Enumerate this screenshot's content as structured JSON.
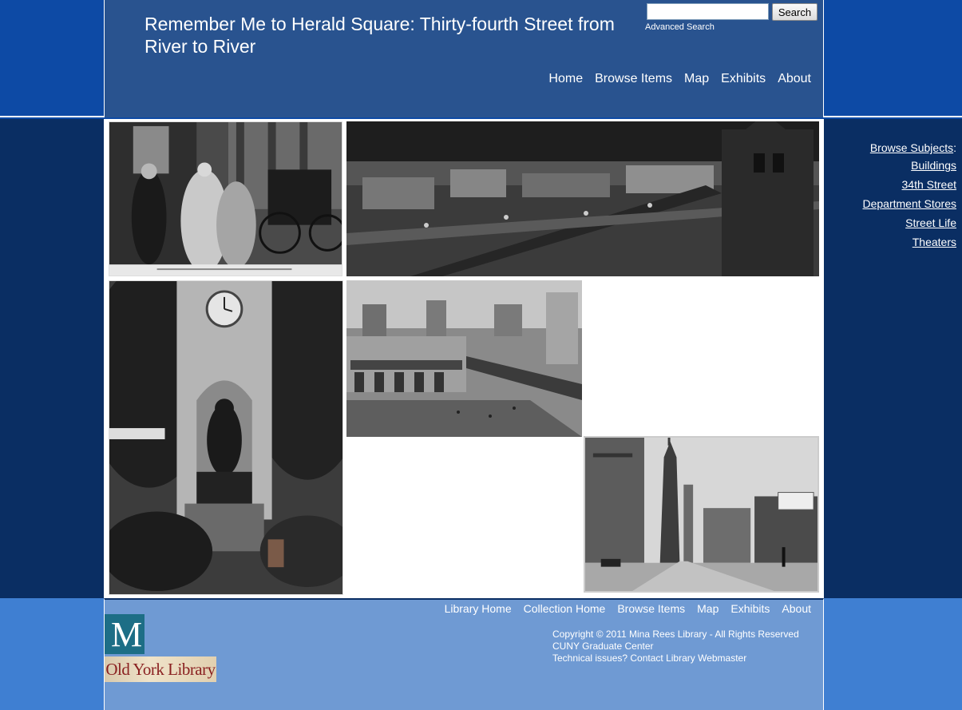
{
  "header": {
    "site_title": "Remember Me to Herald Square: Thirty-fourth Street from River to River",
    "search_placeholder": "",
    "search_button": "Search",
    "advanced_search": "Advanced Search",
    "nav": [
      "Home",
      "Browse Items",
      "Map",
      "Exhibits",
      "About"
    ]
  },
  "sidebar": {
    "browse_subjects": "Browse Subjects",
    "colon": ":",
    "subjects": [
      "Buildings",
      "34th Street",
      "Department Stores",
      "Street Life",
      "Theaters"
    ]
  },
  "gallery": {
    "photos": [
      {
        "subject": "street-scene-carriage-photo"
      },
      {
        "subject": "elevated-railway-panorama-photo"
      },
      {
        "subject": "herald-square-monument-photo"
      },
      {
        "subject": "herald-square-aerial-photo"
      },
      {
        "subject": "empire-state-street-photo"
      }
    ]
  },
  "footer": {
    "nav": [
      "Library Home",
      "Collection Home",
      "Browse Items",
      "Map",
      "Exhibits",
      "About"
    ],
    "copyright_line1": "Copyright © 2011   Mina Rees Library - All Rights Reserved",
    "copyright_line2": "CUNY Graduate Center",
    "copyright_line3": "Technical issues?  Contact Library Webmaster",
    "logo_letter": "M",
    "logo_text": "Old York Library"
  },
  "colors": {
    "outer_blue": "#0d4aa5",
    "header_column": "#29538f",
    "middle_band": "#0a2e63",
    "footer_outer": "#3f7fd2",
    "footer_column": "#6f9ad3"
  }
}
